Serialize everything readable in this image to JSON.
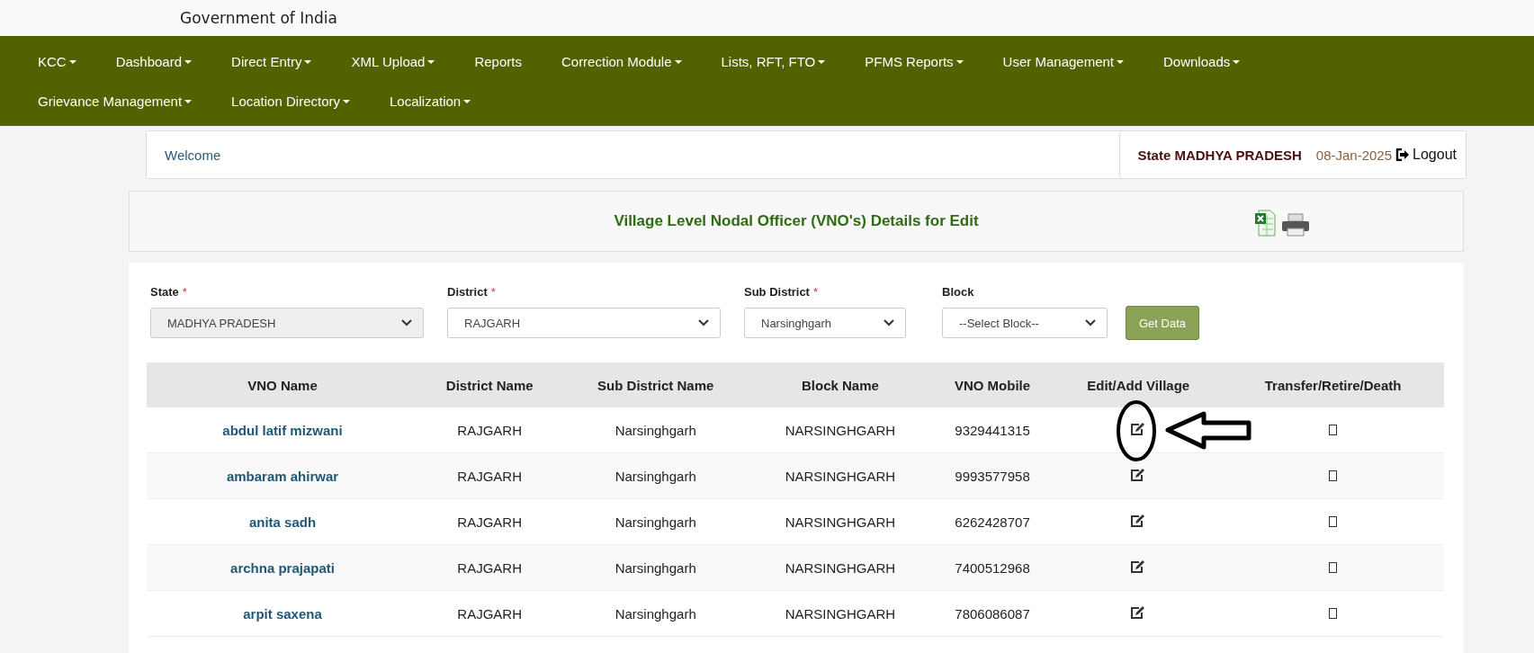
{
  "header": {
    "title": "Government of India"
  },
  "nav": [
    {
      "label": "KCC",
      "dropdown": true
    },
    {
      "label": "Dashboard",
      "dropdown": true
    },
    {
      "label": "Direct Entry",
      "dropdown": true
    },
    {
      "label": "XML Upload",
      "dropdown": true
    },
    {
      "label": "Reports",
      "dropdown": false
    },
    {
      "label": "Correction Module",
      "dropdown": true
    },
    {
      "label": "Lists, RFT, FTO",
      "dropdown": true
    },
    {
      "label": "PFMS Reports",
      "dropdown": true
    },
    {
      "label": "User Management",
      "dropdown": true
    },
    {
      "label": "Downloads",
      "dropdown": true
    },
    {
      "label": "Grievance Management",
      "dropdown": true
    },
    {
      "label": "Location Directory",
      "dropdown": true
    },
    {
      "label": "Localization",
      "dropdown": true
    }
  ],
  "welcome_bar": {
    "greeting": "Welcome",
    "user": "State MADHYA PRADESH",
    "date": "08-Jan-2025",
    "logout": "Logout"
  },
  "panel": {
    "title": "Village Level Nodal Officer (VNO's) Details for Edit"
  },
  "filters": [
    {
      "label": "State",
      "required_mark": "*",
      "value": "MADHYA PRADESH",
      "disabled": true
    },
    {
      "label": "District",
      "required_mark": "*",
      "value": "RAJGARH",
      "disabled": false
    },
    {
      "label": "Sub District",
      "required_mark": "*",
      "value": "Narsinghgarh",
      "disabled": false
    },
    {
      "label": "Block",
      "value": "--Select Block--",
      "disabled": false
    }
  ],
  "get_data_button": "Get Data",
  "table": {
    "columns": [
      "VNO Name",
      "District Name",
      "Sub District Name",
      "Block Name",
      "VNO Mobile",
      "Edit/Add Village",
      "Transfer/Retire/Death"
    ],
    "rows": [
      {
        "name": "abdul latif mizwani",
        "district": "RAJGARH",
        "sub_district": "Narsinghgarh",
        "block": "NARSINGHGARH",
        "mobile": "9329441315",
        "annotated": true
      },
      {
        "name": "ambaram ahirwar",
        "district": "RAJGARH",
        "sub_district": "Narsinghgarh",
        "block": "NARSINGHGARH",
        "mobile": "9993577958",
        "annotated": false
      },
      {
        "name": "anita sadh",
        "district": "RAJGARH",
        "sub_district": "Narsinghgarh",
        "block": "NARSINGHGARH",
        "mobile": "6262428707",
        "annotated": false
      },
      {
        "name": "archna prajapati",
        "district": "RAJGARH",
        "sub_district": "Narsinghgarh",
        "block": "NARSINGHGARH",
        "mobile": "7400512968",
        "annotated": false
      },
      {
        "name": "arpit saxena",
        "district": "RAJGARH",
        "sub_district": "Narsinghgarh",
        "block": "NARSINGHGARH",
        "mobile": "7806086087",
        "annotated": false
      }
    ]
  }
}
